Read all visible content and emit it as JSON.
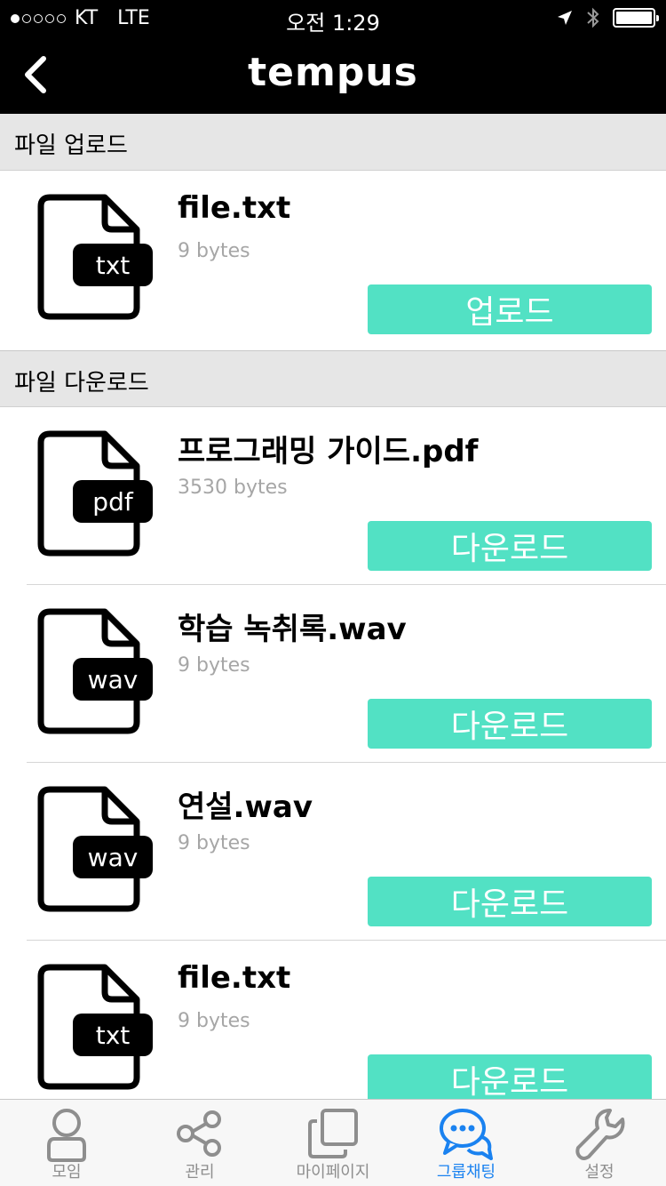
{
  "status_bar": {
    "carrier": "KT",
    "network": "LTE",
    "time": "오전 1:29"
  },
  "nav": {
    "title": "tempus"
  },
  "upload_section": {
    "header": "파일 업로드",
    "items": [
      {
        "icon_label": "txt",
        "name": "file.txt",
        "size": "9 bytes",
        "button": "업로드"
      }
    ]
  },
  "download_section": {
    "header": "파일 다운로드",
    "items": [
      {
        "icon_label": "pdf",
        "name": "프로그래밍 가이드.pdf",
        "size": "3530 bytes",
        "button": "다운로드"
      },
      {
        "icon_label": "wav",
        "name": "학습 녹취록.wav",
        "size": "9 bytes",
        "button": "다운로드"
      },
      {
        "icon_label": "wav",
        "name": "연설.wav",
        "size": "9 bytes",
        "button": "다운로드"
      },
      {
        "icon_label": "txt",
        "name": "file.txt",
        "size": "9 bytes",
        "button": "다운로드"
      }
    ]
  },
  "tabs": [
    {
      "label": "모임",
      "icon": "person-icon",
      "active": false
    },
    {
      "label": "관리",
      "icon": "share-icon",
      "active": false
    },
    {
      "label": "마이페이지",
      "icon": "pages-icon",
      "active": false
    },
    {
      "label": "그룹채팅",
      "icon": "chat-bubbles-icon",
      "active": true
    },
    {
      "label": "설정",
      "icon": "wrench-icon",
      "active": false
    }
  ],
  "colors": {
    "accent": "#52e1c4",
    "tab_active": "#1a82f0",
    "tab_inactive": "#8e8e8e",
    "section_bg": "#e6e6e6"
  }
}
